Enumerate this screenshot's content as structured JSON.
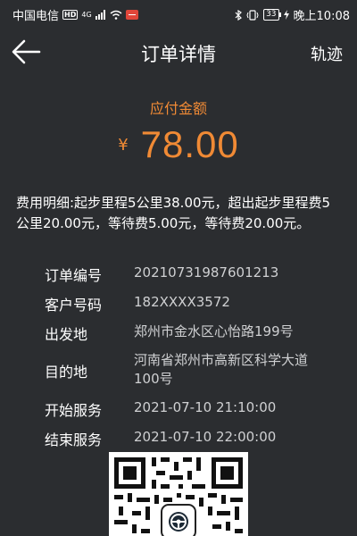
{
  "status_bar": {
    "carrier": "中国电信",
    "hd_badge": "HD",
    "network": "4G",
    "battery": "33",
    "time": "晚上10:08"
  },
  "header": {
    "title": "订单详情",
    "action_label": "轨迹"
  },
  "payment": {
    "label": "应付金额",
    "currency_symbol": "¥",
    "amount": "78.00"
  },
  "fee_detail": "费用明细:起步里程5公里38.00元，超出起步里程费5公里20.00元，等待费5.00元，等待费20.00元。",
  "order_info": [
    {
      "label": "订单编号",
      "value": "20210731987601213"
    },
    {
      "label": "客户号码",
      "value": "182XXXX3572"
    },
    {
      "label": "出发地",
      "value": "郑州市金水区心怡路199号"
    },
    {
      "label": "目的地",
      "value": "河南省郑州市高新区科学大道100号"
    },
    {
      "label": "开始服务",
      "value": "2021-07-10 21:10:00"
    },
    {
      "label": "结束服务",
      "value": "2021-07-10 22:00:00"
    }
  ],
  "colors": {
    "background": "#2b2d30",
    "accent": "#f08a35",
    "text": "#ffffff",
    "secondary_text": "#cfd0d2"
  },
  "icons": {
    "back": "arrow-left-icon",
    "bluetooth": "bluetooth-icon",
    "wifi": "wifi-icon",
    "vibrate": "vibrate-icon",
    "qr_logo": "steering-wheel-icon"
  }
}
